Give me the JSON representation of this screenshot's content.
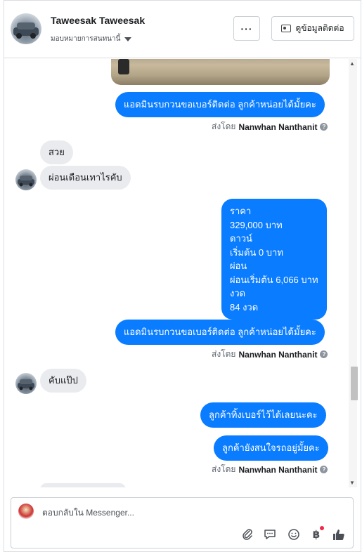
{
  "header": {
    "name": "Taweesak Taweesak",
    "assign_label": "มอบหมายการสนทนานี้",
    "more_label": "···",
    "contact_button": "ดูข้อมูลติดต่อ"
  },
  "messages": {
    "out_1": "แอดมินรบกวนขอเบอร์ติดต่อ ลูกค้าหน่อยได้มั้ยคะ",
    "sent_by_label": "ส่งโดย",
    "sender_name": "Nanwhan Nanthanit",
    "help_glyph": "?",
    "in_1": "สวย",
    "in_2": "ผ่อนเดือนเทาไรคับ",
    "price_lines": [
      "ราคา",
      "329,000 บาท",
      "ดาวน์",
      "เริ่มต้น 0 บาท",
      "ผ่อน",
      "ผ่อนเริ่มต้น 6,066 บาท",
      "งวด",
      "84 งวด"
    ],
    "out_2": "แอดมินรบกวนขอเบอร์ติดต่อ ลูกค้าหน่อยได้มั้ยคะ",
    "in_3": "คับแป๊ป",
    "out_3": "ลูกค้าทิ้งเบอร์ไว้ได้เลยนะคะ",
    "out_4": "ลูกค้ายังสนใจรถอยู่มั้ยคะ"
  },
  "composer": {
    "placeholder": "ตอบกลับใน Messenger..."
  },
  "icons": {
    "attach": "paperclip-icon",
    "saved_reply": "chat-bubble-icon",
    "emoji": "smile-icon",
    "payment": "baht-icon",
    "like": "thumbs-up-icon"
  },
  "colors": {
    "outgoing_bubble": "#0a7cff",
    "incoming_bubble": "#e9ebee",
    "notification_dot": "#f02849"
  }
}
